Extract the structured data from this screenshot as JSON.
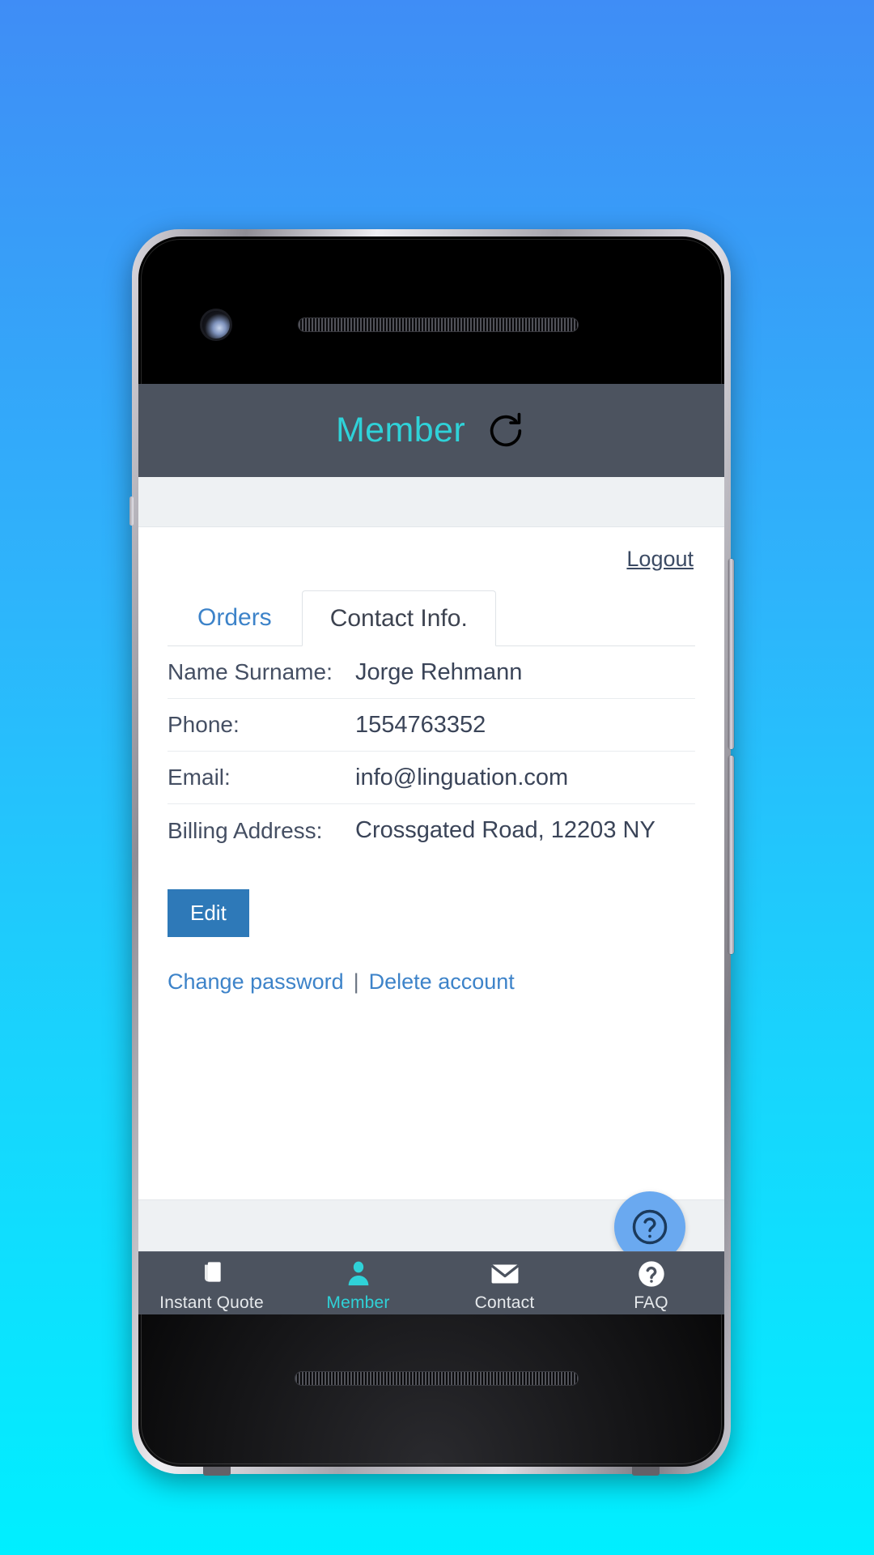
{
  "background": {
    "gradient_top": "#3f8df6",
    "gradient_bottom": "#00efff"
  },
  "theme": {
    "header_bg": "#4c535f",
    "accent_cyan": "#2fd2d8",
    "link_blue": "#3d83c9",
    "button_blue": "#2e79b8",
    "fab_blue": "#6aa9f0",
    "text_dark": "#3a4458"
  },
  "app": {
    "header": {
      "title": "Member",
      "refresh_icon": "refresh-icon"
    }
  },
  "account": {
    "logout_label": "Logout"
  },
  "tabs": [
    {
      "label": "Orders",
      "active": false
    },
    {
      "label": "Contact Info.",
      "active": true
    }
  ],
  "contact_info": {
    "rows": [
      {
        "label": "Name Surname:",
        "value": "Jorge Rehmann"
      },
      {
        "label": "Phone:",
        "value": "1554763352"
      },
      {
        "label": "Email:",
        "value": "info@linguation.com"
      },
      {
        "label": "Billing Address:",
        "value": "Crossgated Road, 12203 NY"
      }
    ]
  },
  "actions": {
    "edit_label": "Edit",
    "change_password_label": "Change password",
    "separator": "|",
    "delete_account_label": "Delete account"
  },
  "help": {
    "icon": "question-mark-circle-icon"
  },
  "bottom_nav": [
    {
      "label": "Instant Quote",
      "icon": "documents-icon",
      "active": false
    },
    {
      "label": "Member",
      "icon": "person-icon",
      "active": true
    },
    {
      "label": "Contact",
      "icon": "envelope-icon",
      "active": false
    },
    {
      "label": "FAQ",
      "icon": "question-mark-circle-icon",
      "active": false
    }
  ]
}
